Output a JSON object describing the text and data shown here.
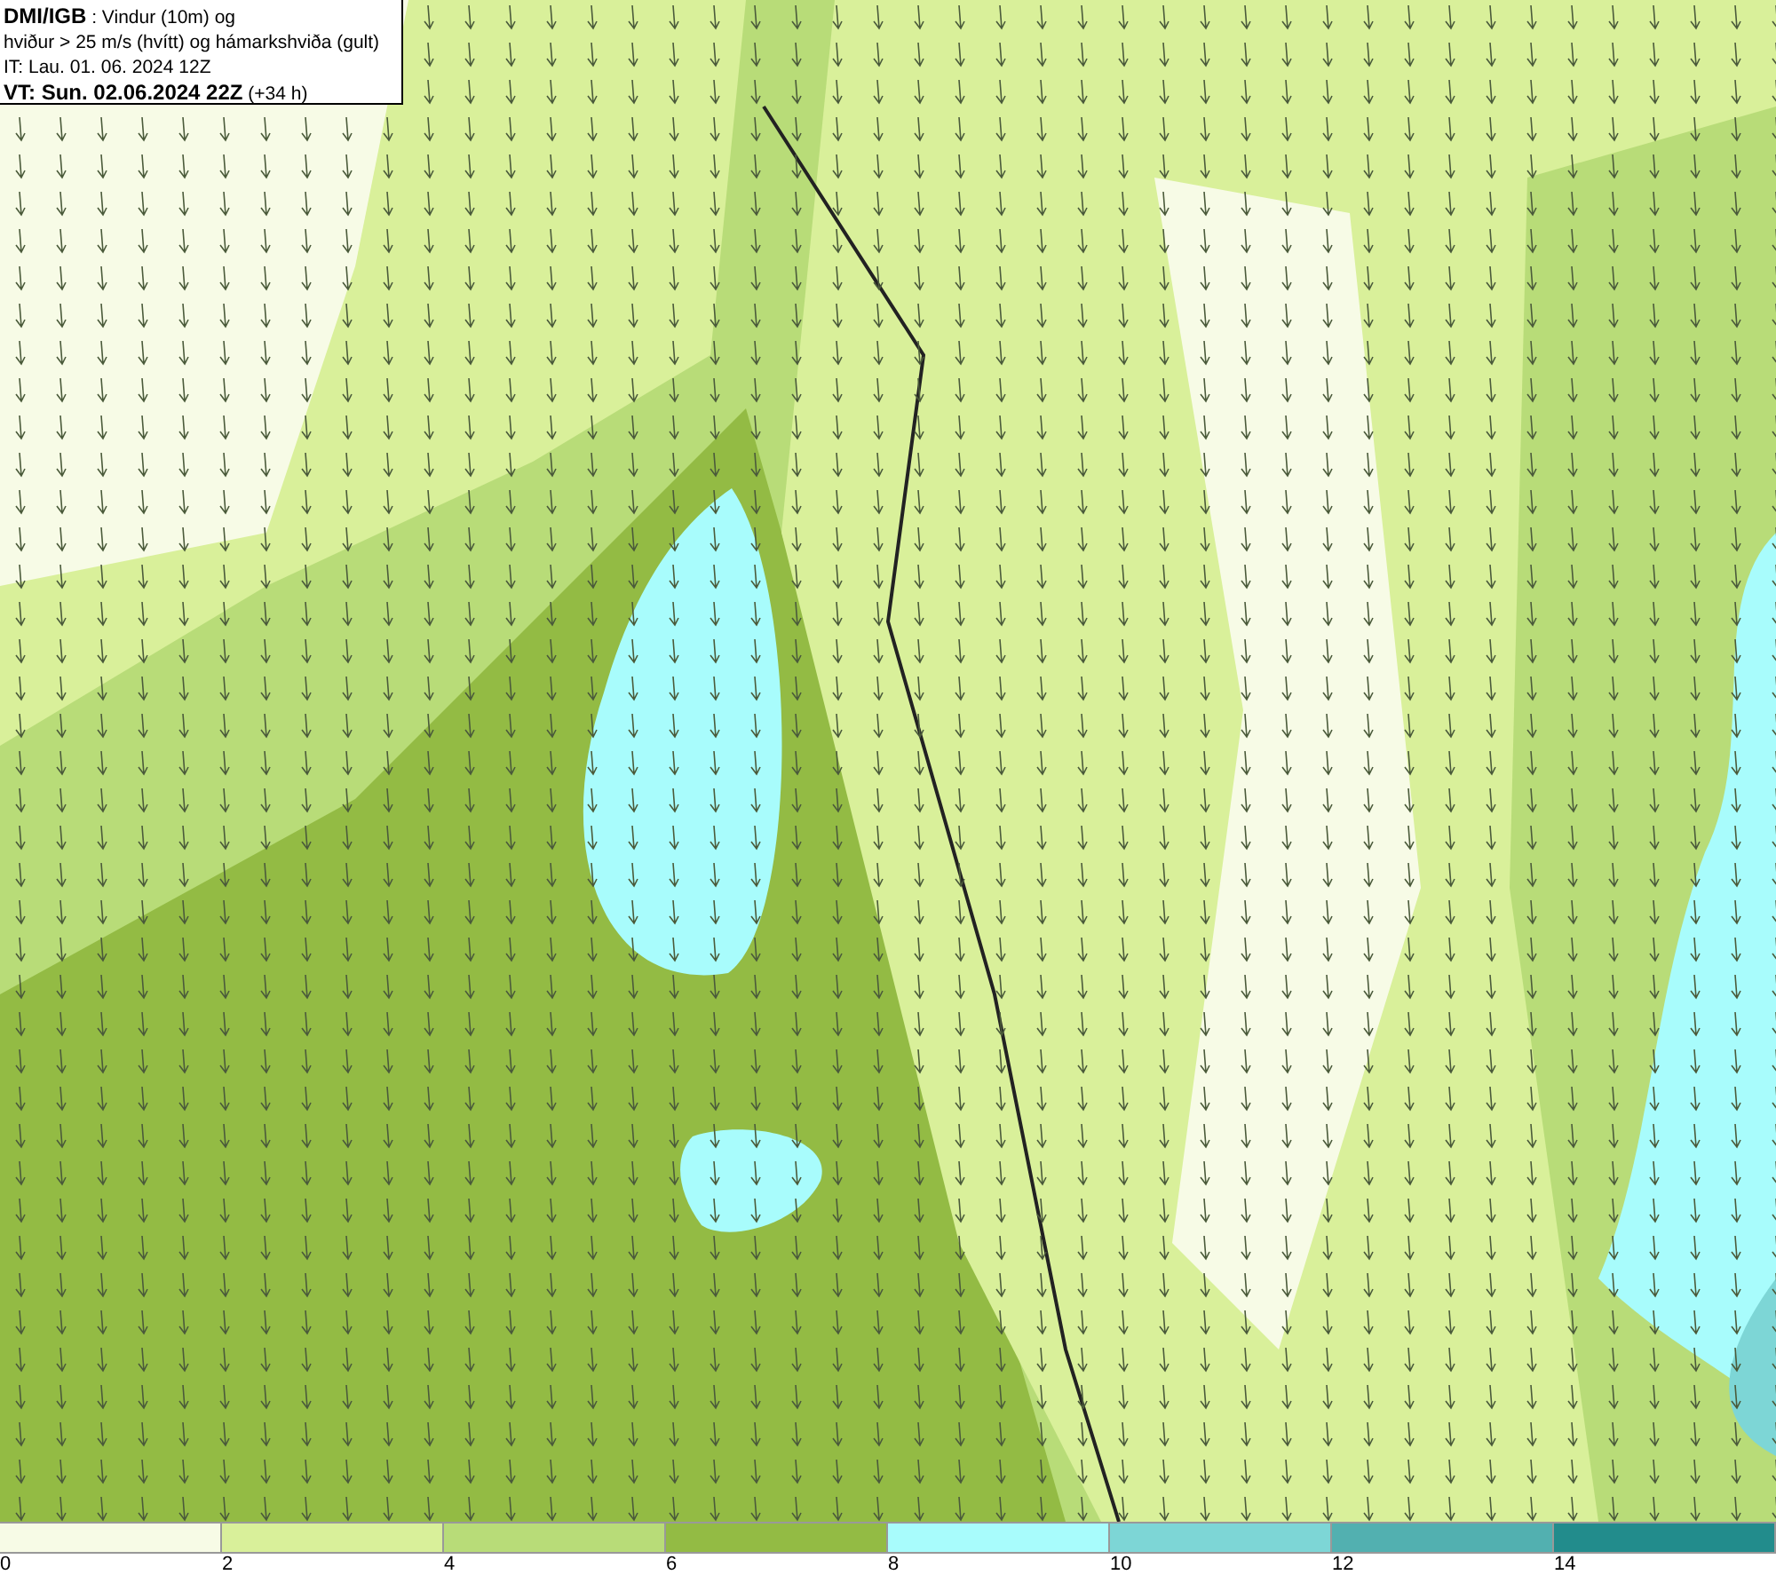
{
  "header": {
    "lines": [
      "**DMI/IGB** : Vindur (10m) og",
      "hviður > 25 m/s (hvítt) og hámarkshviða (gult)",
      "IT: Lau. 01. 06. 2024 12Z",
      "**VT: Sun. 02.06.2024 22Z** (+34 h)"
    ]
  },
  "legend": {
    "bins": [
      {
        "color": "#f7fbe6",
        "label": "0"
      },
      {
        "color": "#d9f09a",
        "label": "2"
      },
      {
        "color": "#b8dc78",
        "label": "4"
      },
      {
        "color": "#93bb44",
        "label": "6"
      },
      {
        "color": "#a8fcfc",
        "label": "8"
      },
      {
        "color": "#7dd6d6",
        "label": "10"
      },
      {
        "color": "#52b0b0",
        "label": "12"
      },
      {
        "color": "#228c8c",
        "label": "14"
      }
    ]
  }
}
